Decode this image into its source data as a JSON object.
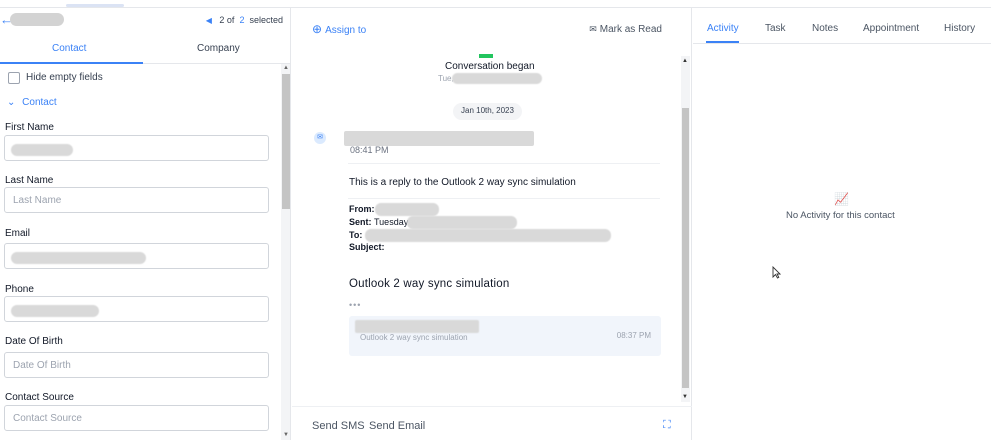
{
  "contact_panel": {
    "back_icon": "arrow-left-icon",
    "pager": {
      "current": "2",
      "of_label": "of",
      "total": "2",
      "selected_label": "selected"
    },
    "tabs": [
      {
        "label": "Contact"
      },
      {
        "label": "Company"
      }
    ],
    "hide_empty_label": "Hide empty fields",
    "section_label": "Contact",
    "fields": [
      {
        "label": "First Name",
        "value": "",
        "placeholder": ""
      },
      {
        "label": "Last Name",
        "value": "",
        "placeholder": "Last Name"
      },
      {
        "label": "Email",
        "value": "",
        "placeholder": ""
      },
      {
        "label": "Phone",
        "value": "",
        "placeholder": ""
      },
      {
        "label": "Date Of Birth",
        "value": "",
        "placeholder": "Date Of Birth"
      },
      {
        "label": "Contact Source",
        "value": "",
        "placeholder": "Contact Source"
      }
    ]
  },
  "conversation": {
    "assign_label": "Assign to",
    "mark_read_label": "Mark as Read",
    "began_label": "Conversation began",
    "began_day": "Tue,",
    "date_chip": "Jan 10th, 2023",
    "message": {
      "time": "08:41 PM",
      "body": "This is a reply to the Outlook 2 way sync simulation",
      "from_label": "From:",
      "sent_label": "Sent:",
      "sent_value": "Tuesday,",
      "to_label": "To:",
      "subject_label": "Subject:",
      "subject": "Outlook 2 way sync simulation",
      "ellipsis": "•••",
      "quoted_text": "Outlook 2 way sync simulation",
      "quoted_time": "08:37 PM"
    },
    "footer": {
      "send_sms": "Send SMS",
      "send_email": "Send Email"
    }
  },
  "activity_panel": {
    "tabs": [
      {
        "label": "Activity",
        "active": true
      },
      {
        "label": "Task"
      },
      {
        "label": "Notes"
      },
      {
        "label": "Appointment"
      },
      {
        "label": "History"
      }
    ],
    "empty_text": "No Activity for this contact"
  },
  "colors": {
    "accent": "#3b82f6",
    "divider": "#e5e7eb",
    "quoted_bg": "#f1f5fb"
  }
}
